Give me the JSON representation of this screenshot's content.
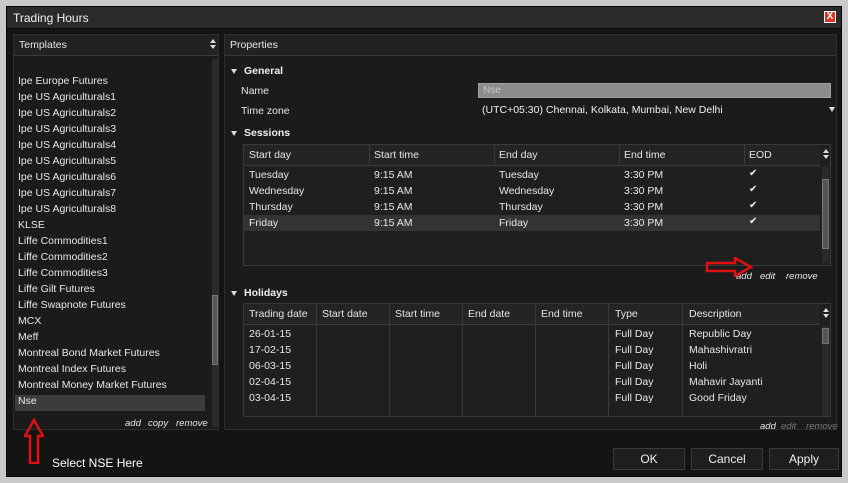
{
  "window": {
    "title": "Trading Hours",
    "close_label": "X"
  },
  "templates": {
    "header": "Templates",
    "items": [
      "Ipe Europe Futures",
      "Ipe US Agriculturals1",
      "Ipe US Agriculturals2",
      "Ipe US Agriculturals3",
      "Ipe US Agriculturals4",
      "Ipe US Agriculturals5",
      "Ipe US Agriculturals6",
      "Ipe US Agriculturals7",
      "Ipe US Agriculturals8",
      "KLSE",
      "Liffe Commodities1",
      "Liffe Commodities2",
      "Liffe Commodities3",
      "Liffe Gilt Futures",
      "Liffe Swapnote Futures",
      "MCX",
      "Meff",
      "Montreal Bond Market Futures",
      "Montreal Index Futures",
      "Montreal Money Market Futures",
      "Nse"
    ],
    "selected": "Nse",
    "actions": {
      "add": "add",
      "copy": "copy",
      "remove": "remove"
    }
  },
  "properties": {
    "header": "Properties",
    "general": {
      "title": "General",
      "name_label": "Name",
      "name_value": "Nse",
      "timezone_label": "Time zone",
      "timezone_value": "(UTC+05:30) Chennai, Kolkata, Mumbai, New Delhi"
    },
    "sessions": {
      "title": "Sessions",
      "columns": [
        "Start day",
        "Start time",
        "End day",
        "End time",
        "EOD"
      ],
      "rows": [
        {
          "start_day": "Tuesday",
          "start_time": "9:15 AM",
          "end_day": "Tuesday",
          "end_time": "3:30 PM",
          "eod": "✔"
        },
        {
          "start_day": "Wednesday",
          "start_time": "9:15 AM",
          "end_day": "Wednesday",
          "end_time": "3:30 PM",
          "eod": "✔"
        },
        {
          "start_day": "Thursday",
          "start_time": "9:15 AM",
          "end_day": "Thursday",
          "end_time": "3:30 PM",
          "eod": "✔"
        },
        {
          "start_day": "Friday",
          "start_time": "9:15 AM",
          "end_day": "Friday",
          "end_time": "3:30 PM",
          "eod": "✔"
        }
      ],
      "actions": {
        "add": "add",
        "edit": "edit",
        "remove": "remove"
      }
    },
    "holidays": {
      "title": "Holidays",
      "columns": [
        "Trading date",
        "Start date",
        "Start time",
        "End date",
        "End time",
        "Type",
        "Description"
      ],
      "rows": [
        {
          "trading_date": "26-01-15",
          "type": "Full Day",
          "description": "Republic Day"
        },
        {
          "trading_date": "17-02-15",
          "type": "Full Day",
          "description": "Mahashivratri"
        },
        {
          "trading_date": "06-03-15",
          "type": "Full Day",
          "description": "Holi"
        },
        {
          "trading_date": "02-04-15",
          "type": "Full Day",
          "description": "Mahavir Jayanti"
        },
        {
          "trading_date": "03-04-15",
          "type": "Full Day",
          "description": "Good Friday"
        }
      ],
      "actions": {
        "add": "add",
        "edit": "edit",
        "remove": "remove"
      }
    }
  },
  "buttons": {
    "ok": "OK",
    "cancel": "Cancel",
    "apply": "Apply"
  },
  "annotation": {
    "text": "Select NSE Here",
    "arrow_color": "#e01010"
  },
  "colors": {
    "background": "#141414",
    "selection": "#3c3c3c",
    "close": "#d8341e"
  }
}
